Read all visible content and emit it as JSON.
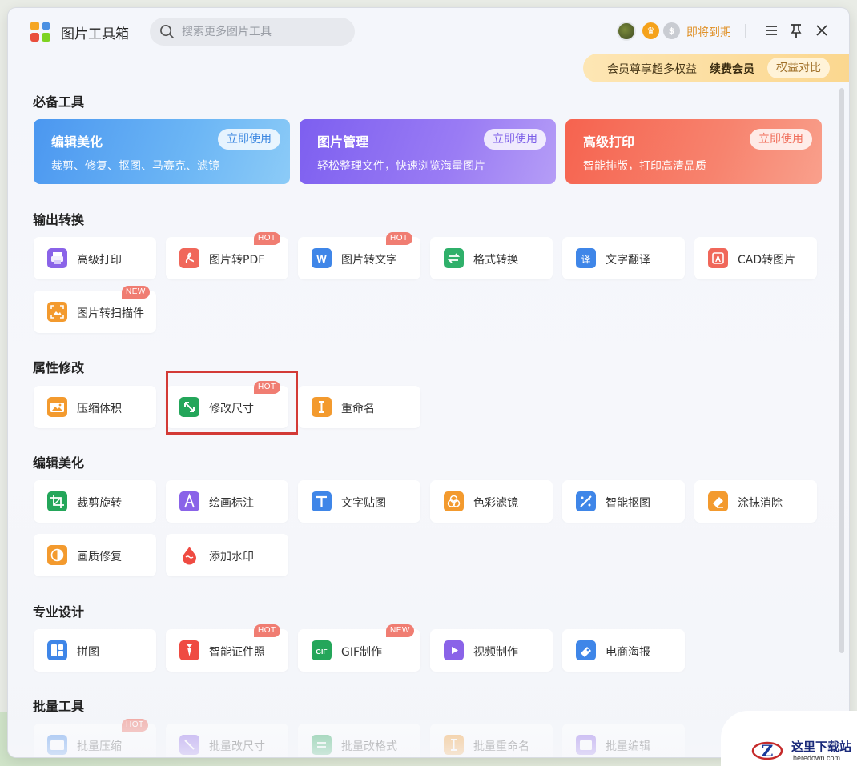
{
  "header": {
    "title": "图片工具箱",
    "search_placeholder": "搜索更多图片工具",
    "expire_label": "即将到期",
    "vip_text": "会员尊享超多权益",
    "vip_renew": "续费会员",
    "vip_compare": "权益对比"
  },
  "sections": {
    "essential": "必备工具",
    "output": "输出转换",
    "attribute": "属性修改",
    "edit": "编辑美化",
    "design": "专业设计",
    "batch": "批量工具"
  },
  "featured": [
    {
      "title": "编辑美化",
      "desc": "裁剪、修复、抠图、马赛克、滤镜",
      "button": "立即使用",
      "color": "#4ea2f2"
    },
    {
      "title": "图片管理",
      "desc": "轻松整理文件，快速浏览海量图片",
      "button": "立即使用",
      "color": "#8a6cf0"
    },
    {
      "title": "高级打印",
      "desc": "智能排版，打印高清品质",
      "button": "立即使用",
      "color": "#f6725e"
    }
  ],
  "output_tools": [
    {
      "label": "高级打印",
      "icon": "printer-icon",
      "badge": ""
    },
    {
      "label": "图片转PDF",
      "icon": "pdf-icon",
      "badge": "HOT"
    },
    {
      "label": "图片转文字",
      "icon": "word-icon",
      "badge": "HOT"
    },
    {
      "label": "格式转换",
      "icon": "format-convert-icon",
      "badge": ""
    },
    {
      "label": "文字翻译",
      "icon": "translate-icon",
      "badge": ""
    },
    {
      "label": "CAD转图片",
      "icon": "cad-icon",
      "badge": ""
    },
    {
      "label": "图片转扫描件",
      "icon": "scan-icon",
      "badge": "NEW"
    }
  ],
  "attribute_tools": [
    {
      "label": "压缩体积",
      "icon": "compress-icon",
      "badge": ""
    },
    {
      "label": "修改尺寸",
      "icon": "resize-icon",
      "badge": "HOT"
    },
    {
      "label": "重命名",
      "icon": "rename-icon",
      "badge": ""
    }
  ],
  "edit_tools": [
    {
      "label": "裁剪旋转",
      "icon": "crop-icon",
      "badge": ""
    },
    {
      "label": "绘画标注",
      "icon": "draw-icon",
      "badge": ""
    },
    {
      "label": "文字贴图",
      "icon": "text-icon",
      "badge": ""
    },
    {
      "label": "色彩滤镜",
      "icon": "filter-icon",
      "badge": ""
    },
    {
      "label": "智能抠图",
      "icon": "cutout-icon",
      "badge": ""
    },
    {
      "label": "涂抹消除",
      "icon": "eraser-icon",
      "badge": ""
    },
    {
      "label": "画质修复",
      "icon": "quality-icon",
      "badge": ""
    },
    {
      "label": "添加水印",
      "icon": "watermark-icon",
      "badge": ""
    }
  ],
  "design_tools": [
    {
      "label": "拼图",
      "icon": "collage-icon",
      "badge": ""
    },
    {
      "label": "智能证件照",
      "icon": "id-photo-icon",
      "badge": "HOT"
    },
    {
      "label": "GIF制作",
      "icon": "gif-icon",
      "badge": "NEW"
    },
    {
      "label": "视频制作",
      "icon": "video-icon",
      "badge": ""
    },
    {
      "label": "电商海报",
      "icon": "poster-icon",
      "badge": ""
    }
  ],
  "batch_tools": [
    {
      "label": "批量压缩",
      "icon": "batch-compress-icon",
      "badge": "HOT"
    },
    {
      "label": "批量改尺寸",
      "icon": "batch-resize-icon",
      "badge": ""
    },
    {
      "label": "批量改格式",
      "icon": "batch-format-icon",
      "badge": ""
    },
    {
      "label": "批量重命名",
      "icon": "batch-rename-icon",
      "badge": ""
    },
    {
      "label": "批量编辑",
      "icon": "batch-edit-icon",
      "badge": ""
    }
  ],
  "watermark": {
    "cn": "这里下载站",
    "en": "heredown.com"
  }
}
